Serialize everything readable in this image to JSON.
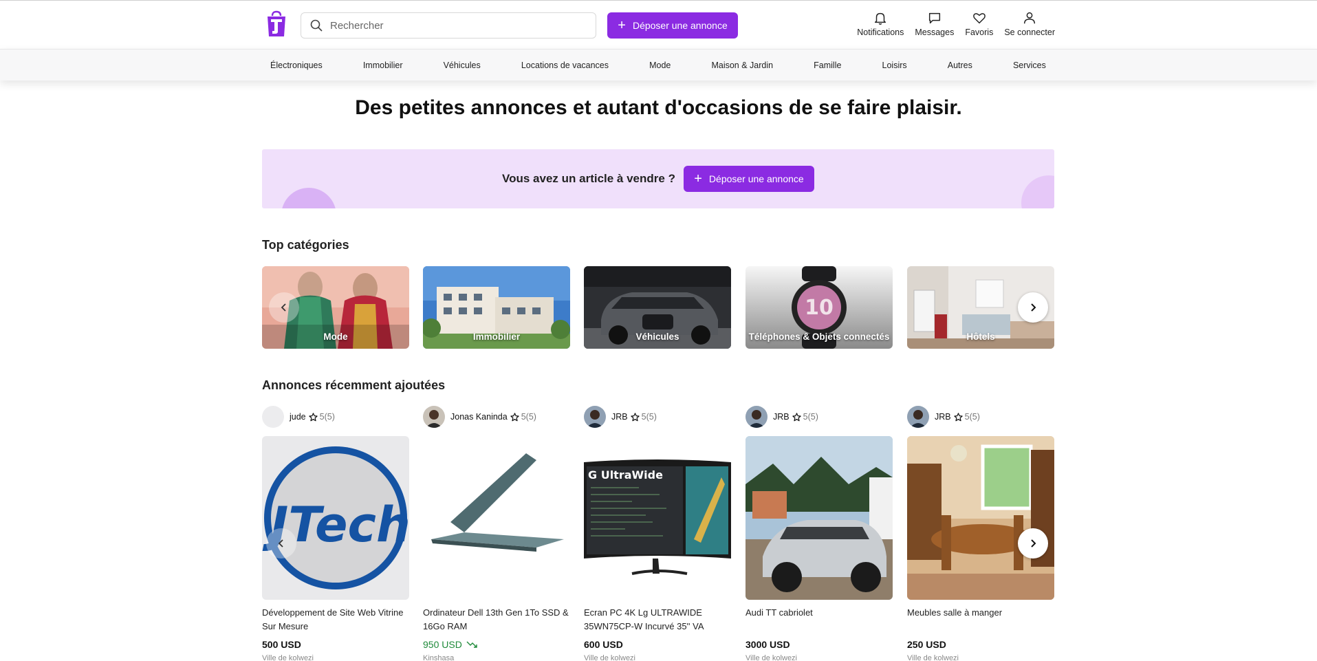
{
  "header": {
    "search_placeholder": "Rechercher",
    "post_label": "Déposer une annonce",
    "icons": [
      {
        "label": "Notifications",
        "icon": "bell-icon"
      },
      {
        "label": "Messages",
        "icon": "chat-icon"
      },
      {
        "label": "Favoris",
        "icon": "heart-icon"
      },
      {
        "label": "Se connecter",
        "icon": "user-icon"
      }
    ]
  },
  "nav": {
    "items": [
      "Électroniques",
      "Immobilier",
      "Véhicules",
      "Locations de vacances",
      "Mode",
      "Maison & Jardin",
      "Famille",
      "Loisirs",
      "Autres",
      "Services"
    ]
  },
  "hero": {
    "title": "Des petites annonces et autant d'occasions de se faire plaisir.",
    "promo_text": "Vous avez un article à vendre ?",
    "promo_button": "Déposer une annonce"
  },
  "top_categories": {
    "title": "Top catégories",
    "items": [
      "Mode",
      "Immobilier",
      "Véhicules",
      "Téléphones & Objets connectés",
      "Hôtels"
    ]
  },
  "recent": {
    "title": "Annonces récemment ajoutées",
    "items": [
      {
        "seller": "jude",
        "rating": "5(5)",
        "title": "Développement de Site Web Vitrine Sur Mesure",
        "price": "500 USD",
        "location": "Ville de kolwezi"
      },
      {
        "seller": "Jonas Kaninda",
        "rating": "5(5)",
        "title": "Ordinateur Dell 13th Gen 1To SSD & 16Go RAM",
        "price": "950 USD",
        "location": "Kinshasa"
      },
      {
        "seller": "JRB",
        "rating": "5(5)",
        "title": "Ecran PC 4K Lg ULTRAWIDE 35WN75CP-W Incurvé 35'' VA",
        "price": "600 USD",
        "location": "Ville de kolwezi"
      },
      {
        "seller": "JRB",
        "rating": "5(5)",
        "title": "Audi TT cabriolet",
        "price": "3000 USD",
        "location": "Ville de kolwezi"
      },
      {
        "seller": "JRB",
        "rating": "5(5)",
        "title": "Meubles salle à manger",
        "price": "250 USD",
        "location": "Ville de kolwezi"
      }
    ],
    "monitor_brand_text": "G UltraWide",
    "logo_text": "JTech"
  },
  "colors": {
    "accent": "#8b2be2",
    "promo_bg": "#f0e0fb",
    "price_drop": "#1f8a3a"
  }
}
